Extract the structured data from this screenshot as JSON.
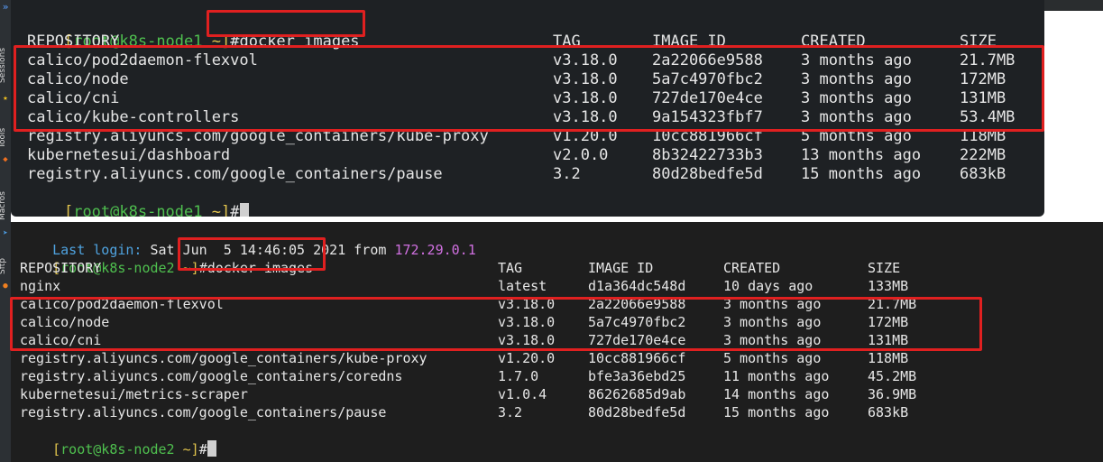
{
  "sidebar": {
    "labels": [
      "Sessions",
      "Tools",
      "Macros",
      "Sftp"
    ]
  },
  "terminal1": {
    "prompt": {
      "user": "root@k8s-node1",
      "path": "~"
    },
    "command": "#docker images",
    "headers": [
      "REPOSITORY",
      "TAG",
      "IMAGE ID",
      "CREATED",
      "SIZE"
    ],
    "rows": [
      [
        "calico/pod2daemon-flexvol",
        "v3.18.0",
        "2a22066e9588",
        "3 months ago",
        "21.7MB"
      ],
      [
        "calico/node",
        "v3.18.0",
        "5a7c4970fbc2",
        "3 months ago",
        "172MB"
      ],
      [
        "calico/cni",
        "v3.18.0",
        "727de170e4ce",
        "3 months ago",
        "131MB"
      ],
      [
        "calico/kube-controllers",
        "v3.18.0",
        "9a154323fbf7",
        "3 months ago",
        "53.4MB"
      ],
      [
        "registry.aliyuncs.com/google_containers/kube-proxy",
        "v1.20.0",
        "10cc881966cf",
        "5 months ago",
        "118MB"
      ],
      [
        "kubernetesui/dashboard",
        "v2.0.0",
        "8b32422733b3",
        "13 months ago",
        "222MB"
      ],
      [
        "registry.aliyuncs.com/google_containers/pause",
        "3.2",
        "80d28bedfe5d",
        "15 months ago",
        "683kB"
      ]
    ],
    "final_prompt": "#"
  },
  "terminal2": {
    "last_login_label": "Last login:",
    "last_login_date": "Sat Jun  5 14:46:05 2021 from",
    "last_login_ip": "172.29.0.1",
    "prompt": {
      "user": "root@k8s-node2",
      "path": "~"
    },
    "command": "#docker images",
    "headers": [
      "REPOSITORY",
      "TAG",
      "IMAGE ID",
      "CREATED",
      "SIZE"
    ],
    "rows": [
      [
        "nginx",
        "latest",
        "d1a364dc548d",
        "10 days ago",
        "133MB"
      ],
      [
        "calico/pod2daemon-flexvol",
        "v3.18.0",
        "2a22066e9588",
        "3 months ago",
        "21.7MB"
      ],
      [
        "calico/node",
        "v3.18.0",
        "5a7c4970fbc2",
        "3 months ago",
        "172MB"
      ],
      [
        "calico/cni",
        "v3.18.0",
        "727de170e4ce",
        "3 months ago",
        "131MB"
      ],
      [
        "registry.aliyuncs.com/google_containers/kube-proxy",
        "v1.20.0",
        "10cc881966cf",
        "5 months ago",
        "118MB"
      ],
      [
        "registry.aliyuncs.com/google_containers/coredns",
        "1.7.0",
        "bfe3a36ebd25",
        "11 months ago",
        "45.2MB"
      ],
      [
        "kubernetesui/metrics-scraper",
        "v1.0.4",
        "86262685d9ab",
        "14 months ago",
        "36.9MB"
      ],
      [
        "registry.aliyuncs.com/google_containers/pause",
        "3.2",
        "80d28bedfe5d",
        "15 months ago",
        "683kB"
      ]
    ],
    "final_prompt": "#"
  },
  "colors": {
    "prompt_user": "#4fc04f",
    "prompt_bracket": "#e0c34c",
    "highlight_box": "#e02020",
    "last_login": "#4fa3e0",
    "ip": "#d070e0"
  },
  "icons": [
    "expand-arrow-icon",
    "star-icon",
    "tools-icon",
    "send-icon",
    "sftp-icon"
  ]
}
